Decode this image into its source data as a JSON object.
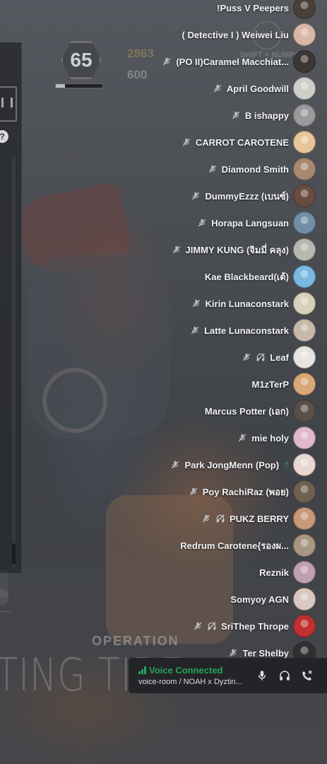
{
  "game": {
    "level": "65",
    "level_progress": 0.2,
    "currency_1": "2863",
    "currency_2": "600",
    "keybind_hint": "SHIFT + NUMPAD",
    "operation_label": "OPERATION",
    "title_text": "TING TIDE"
  },
  "voice_users": [
    {
      "name": "!Puss V Peepers",
      "muted": false,
      "deafened": false,
      "hand": false,
      "avatar_color": "#4a4038"
    },
    {
      "name": "( Detective I ) Weiwei Liu",
      "muted": false,
      "deafened": false,
      "hand": false,
      "avatar_color": "#d9b7a6"
    },
    {
      "name": "(PO II)Caramel Macchiat...",
      "muted": true,
      "deafened": false,
      "hand": false,
      "avatar_color": "#3c3634"
    },
    {
      "name": "April Goodwill",
      "muted": true,
      "deafened": false,
      "hand": false,
      "avatar_color": "#cfcfc8"
    },
    {
      "name": "B ishappy",
      "muted": true,
      "deafened": false,
      "hand": false,
      "avatar_color": "#9a9a9a"
    },
    {
      "name": "CARROT CAROTENE",
      "muted": true,
      "deafened": false,
      "hand": false,
      "avatar_color": "#e8c49a"
    },
    {
      "name": "Diamond Smith",
      "muted": true,
      "deafened": false,
      "hand": false,
      "avatar_color": "#a88870"
    },
    {
      "name": "DummyEzzz (เบนซ์)",
      "muted": true,
      "deafened": false,
      "hand": false,
      "avatar_color": "#6b4a40"
    },
    {
      "name": "Horapa Langsuan",
      "muted": true,
      "deafened": false,
      "hand": false,
      "avatar_color": "#6f8fa8"
    },
    {
      "name": "JIMMY KUNG (จิมมี่ คลุง)",
      "muted": true,
      "deafened": false,
      "hand": false,
      "avatar_color": "#b8b8b0"
    },
    {
      "name": "Kae Blackbeard(เต้)",
      "muted": false,
      "deafened": false,
      "hand": false,
      "avatar_color": "#7ab8e0"
    },
    {
      "name": "Kirin Lunaconstark",
      "muted": true,
      "deafened": false,
      "hand": false,
      "avatar_color": "#d8d0b8"
    },
    {
      "name": "Latte Lunaconstark",
      "muted": true,
      "deafened": false,
      "hand": false,
      "avatar_color": "#c8b8a8"
    },
    {
      "name": "Leaf",
      "muted": true,
      "deafened": true,
      "hand": false,
      "avatar_color": "#e8e4e0"
    },
    {
      "name": "M1zTerP",
      "muted": false,
      "deafened": false,
      "hand": false,
      "avatar_color": "#d8a878"
    },
    {
      "name": "Marcus Potter (เอก)",
      "muted": false,
      "deafened": false,
      "hand": false,
      "avatar_color": "#5a5048"
    },
    {
      "name": "mie holy",
      "muted": true,
      "deafened": false,
      "hand": false,
      "avatar_color": "#e0b8c8"
    },
    {
      "name": "Park JongMenn (Pop)",
      "muted": true,
      "deafened": false,
      "hand": true,
      "avatar_color": "#e8d8d0"
    },
    {
      "name": "Poy RachiRaz (พอย)",
      "muted": true,
      "deafened": false,
      "hand": false,
      "avatar_color": "#706050"
    },
    {
      "name": "PUKZ BERRY",
      "muted": true,
      "deafened": true,
      "hand": false,
      "avatar_color": "#c89878"
    },
    {
      "name": "Redrum Carotene{รองผ...",
      "muted": false,
      "deafened": false,
      "hand": false,
      "avatar_color": "#a89880"
    },
    {
      "name": "Reznik",
      "muted": false,
      "deafened": false,
      "hand": false,
      "avatar_color": "#c0a0b0"
    },
    {
      "name": "Somyoy AGN",
      "muted": false,
      "deafened": false,
      "hand": false,
      "avatar_color": "#d8c8c0"
    },
    {
      "name": "SriThep Thrope",
      "muted": true,
      "deafened": true,
      "hand": false,
      "avatar_color": "#c03030"
    },
    {
      "name": "Ter Shelby",
      "muted": true,
      "deafened": false,
      "hand": false,
      "avatar_color": "#303030"
    }
  ],
  "voice_bar": {
    "status": "Voice Connected",
    "channel": "voice-room / NOAH x Dyztin...",
    "status_color": "#23a55a"
  }
}
